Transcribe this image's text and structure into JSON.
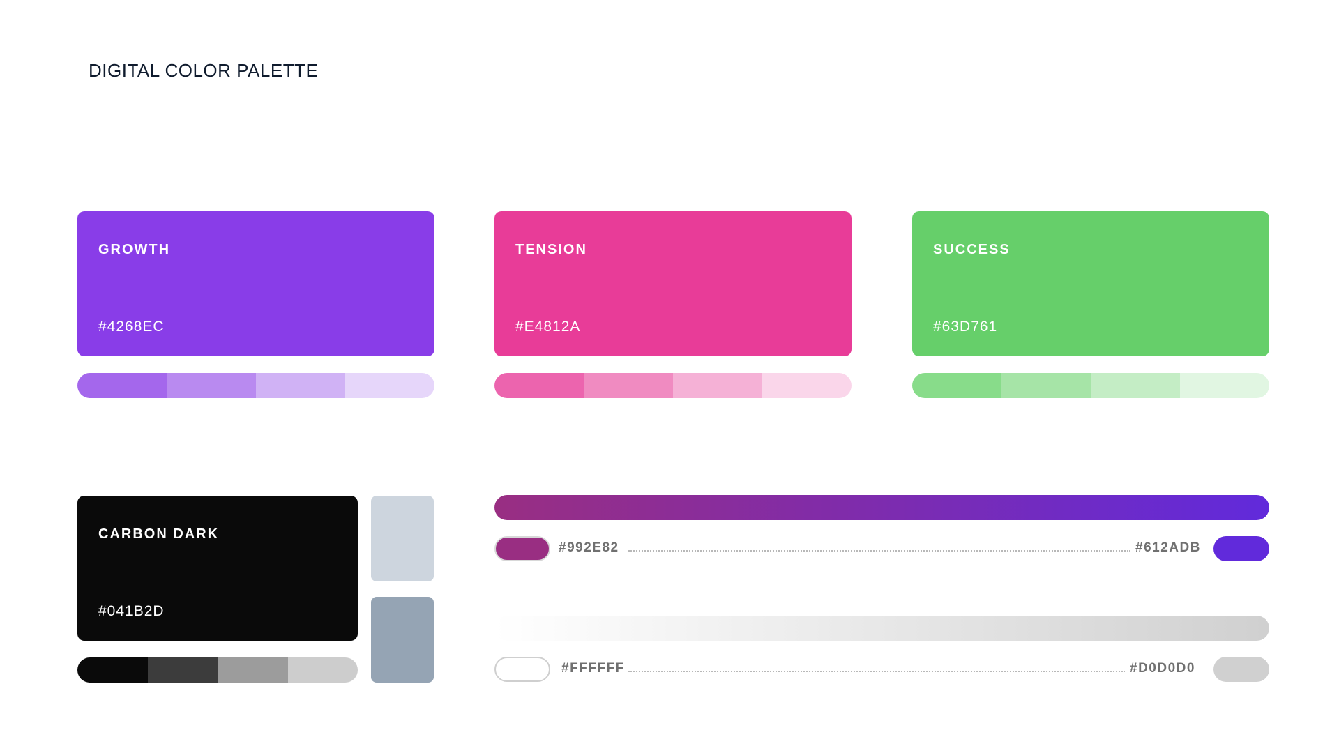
{
  "title": "DIGITAL COLOR PALETTE",
  "swatches": [
    {
      "name": "GROWTH",
      "hex": "#4268EC",
      "color": "#893DE8",
      "tints": [
        "#A467EC",
        "#B98AF0",
        "#D0B2F5",
        "#E6D6FA"
      ]
    },
    {
      "name": "TENSION",
      "hex": "#E4812A",
      "color": "#E83C98",
      "tints": [
        "#EC64AE",
        "#F08BC1",
        "#F5B1D6",
        "#FAD6EA"
      ]
    },
    {
      "name": "SUCCESS",
      "hex": "#63D761",
      "color": "#66CF6A",
      "tints": [
        "#88DC8A",
        "#A6E4A7",
        "#C4EDC5",
        "#E1F6E2"
      ]
    }
  ],
  "carbon": {
    "name": "CARBON DARK",
    "hex": "#041B2D",
    "color": "#0A0A0A",
    "tints": [
      "#0A0A0A",
      "#3C3C3C",
      "#9C9C9C",
      "#CDCDCD"
    ],
    "side_swatches": [
      "#CDD5DE",
      "#95A4B4"
    ]
  },
  "gradients": [
    {
      "start_hex": "#992E82",
      "end_hex": "#612ADB",
      "start_color": "#992E82",
      "end_color": "#612ADB"
    },
    {
      "start_hex": "#FFFFFF",
      "end_hex": "#D0D0D0",
      "start_color": "#FFFFFF",
      "end_color": "#D0D0D0"
    }
  ]
}
